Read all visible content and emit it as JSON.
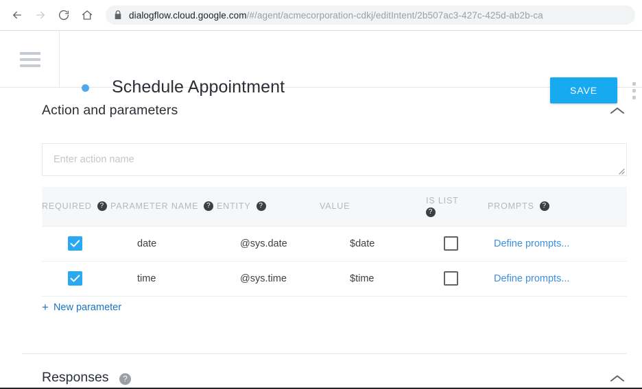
{
  "browser": {
    "back_icon": "arrow-left-icon",
    "forward_icon": "arrow-right-icon",
    "reload_icon": "reload-icon",
    "home_icon": "home-icon",
    "lock_icon": "lock-icon",
    "url_host": "dialogflow.cloud.google.com",
    "url_path": "/#/agent/acmecorporation-cdkj/editIntent/2b507ac3-427c-425d-ab2b-ca"
  },
  "header": {
    "menu_icon": "hamburger-menu-icon",
    "status_dot": "intent-status-dot",
    "intent_title": "Schedule Appointment",
    "save_label": "SAVE",
    "overflow_icon": "more-vertical-icon",
    "accent_color": "#17aaf0"
  },
  "action_section": {
    "title": "Action and parameters",
    "collapse_icon": "chevron-up-icon",
    "action_placeholder": "Enter action name",
    "action_value": "",
    "resize_icon": "resize-grip-icon",
    "columns": [
      {
        "label": "REQUIRED",
        "help": true
      },
      {
        "label": "PARAMETER NAME",
        "help": true
      },
      {
        "label": "ENTITY",
        "help": true
      },
      {
        "label": "VALUE",
        "help": false
      },
      {
        "label": "IS LIST",
        "help": true
      },
      {
        "label": "PROMPTS",
        "help": true
      }
    ],
    "rows": [
      {
        "required": true,
        "name": "date",
        "entity": "@sys.date",
        "value": "$date",
        "is_list": false,
        "prompts_label": "Define prompts..."
      },
      {
        "required": true,
        "name": "time",
        "entity": "@sys.time",
        "value": "$time",
        "is_list": false,
        "prompts_label": "Define prompts..."
      }
    ],
    "new_parameter_label": "New parameter",
    "new_parameter_icon": "plus-icon",
    "link_color": "#3b8fdd"
  },
  "responses_section": {
    "title": "Responses",
    "help_icon": "help-circle-icon",
    "collapse_icon": "chevron-up-icon"
  },
  "help_glyph": "?"
}
